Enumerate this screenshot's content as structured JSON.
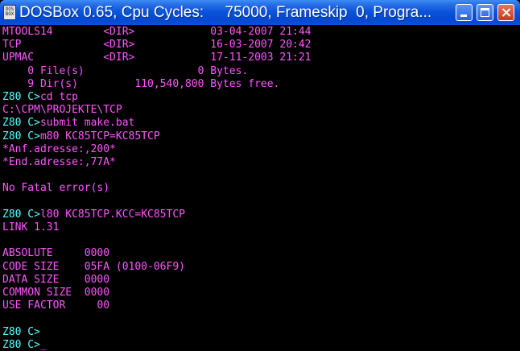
{
  "window": {
    "icon_label": "DOS BOX",
    "title": "DOSBox 0.65, Cpu Cycles:     75000, Frameskip  0, Progra..."
  },
  "console": {
    "lines": [
      {
        "text": "MTOOLS14        <DIR>            03-04-2007 21:44"
      },
      {
        "text": "TCP             <DIR>            16-03-2007 20:42"
      },
      {
        "text": "UPMAC           <DIR>            17-11-2003 21:21"
      },
      {
        "text": "    0 File(s)                  0 Bytes."
      },
      {
        "text": "    9 Dir(s)         110,540,800 Bytes free."
      },
      {
        "prompt": "Z80 C>",
        "text": "cd tcp"
      },
      {
        "text": "C:\\CPM\\PROJEKTE\\TCP"
      },
      {
        "prompt": "Z80 C>",
        "text": "submit make.bat"
      },
      {
        "prompt": "Z80 C>",
        "text": "m80 KC85TCP=KC85TCP"
      },
      {
        "text": "*Anf.adresse:,200*"
      },
      {
        "text": "*End.adresse:,77A*"
      },
      {
        "text": ""
      },
      {
        "text": "No Fatal error(s)"
      },
      {
        "text": ""
      },
      {
        "prompt": "Z80 C>",
        "text": "l80 KC85TCP.KCC=KC85TCP"
      },
      {
        "text": "LINK 1.31"
      },
      {
        "text": ""
      },
      {
        "text": "ABSOLUTE     0000"
      },
      {
        "text": "CODE SIZE    05FA (0100-06F9)"
      },
      {
        "text": "DATA SIZE    0000"
      },
      {
        "text": "COMMON SIZE  0000"
      },
      {
        "text": "USE FACTOR     00"
      },
      {
        "text": ""
      },
      {
        "prompt": "Z80 C>",
        "text": ""
      },
      {
        "prompt": "Z80 C>",
        "text": "",
        "cursor": "_"
      }
    ]
  },
  "colors": {
    "text": "#ff55ff",
    "prompt": "#55ffff",
    "background": "#000000",
    "titlebar": "#0a55dd"
  }
}
